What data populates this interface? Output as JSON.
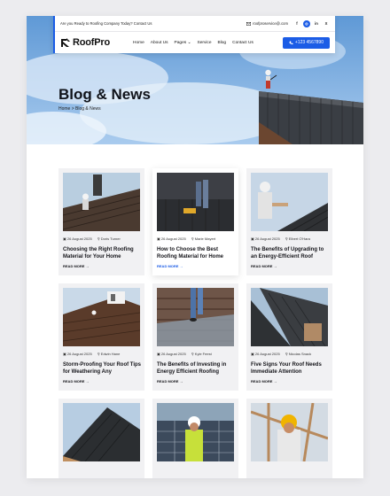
{
  "topbar": {
    "tagline": "Are you Ready to Roofing Company Today? Contact Us",
    "email": "roofproservice@.com",
    "socials": [
      "f",
      "◎",
      "in",
      "X"
    ]
  },
  "nav": {
    "logo": "RoofPro",
    "items": [
      "Home",
      "About Us",
      "Pages ⌄",
      "Service",
      "Blog",
      "Contact Us"
    ],
    "phone": "+123 4567890"
  },
  "hero": {
    "title": "Blog & News",
    "breadcrumb": "Home > Blog & News"
  },
  "posts": [
    {
      "date": "26 August 2025",
      "author": "Doris Turner",
      "title": "Choosing the Right Roofing Material for Your Home",
      "cta": "READ MORE →"
    },
    {
      "date": "26 August 2025",
      "author": "Marie Mayert",
      "title": "How to Choose the Best Roofing Material for Home",
      "cta": "READ MORE →"
    },
    {
      "date": "26 August 2025",
      "author": "Elbert O'Hara",
      "title": "The Benefits of Upgrading to an Energy-Efficient Roof",
      "cta": "READ MORE →"
    },
    {
      "date": "26 August 2025",
      "author": "Edwin Hane",
      "title": "Storm-Proofing Your Roof Tips for Weathering Any",
      "cta": "READ MORE →"
    },
    {
      "date": "26 August 2025",
      "author": "Kyle Feest",
      "title": "The Benefits of Investing in Energy Efficient Roofing",
      "cta": "READ MORE →"
    },
    {
      "date": "26 August 2025",
      "author": "Nicolas Snack",
      "title": "Five Signs Your Roof Needs Immediate Attention",
      "cta": "READ MORE →"
    }
  ],
  "colors": {
    "accent": "#1b5ce6",
    "card_bg": "#f1f1f3",
    "sky": "#6fa6dc"
  },
  "icons": {
    "calendar": "calendar-icon",
    "user": "user-icon",
    "mail": "mail-icon",
    "phone": "phone-icon"
  }
}
